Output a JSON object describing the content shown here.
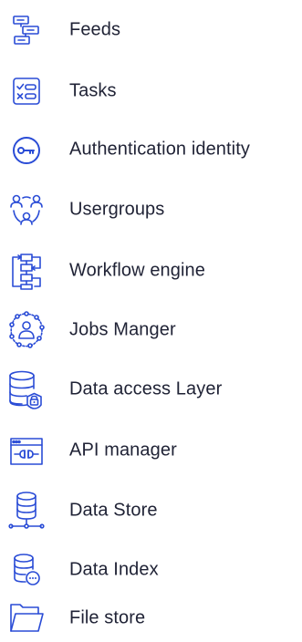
{
  "accent_color": "#2a4cd6",
  "text_color": "#1f2235",
  "menu": {
    "items": [
      {
        "label": "Feeds",
        "icon": "feeds-icon"
      },
      {
        "label": "Tasks",
        "icon": "tasks-icon"
      },
      {
        "label": "Authentication identity",
        "icon": "key-icon"
      },
      {
        "label": "Usergroups",
        "icon": "usergroups-icon"
      },
      {
        "label": "Workflow engine",
        "icon": "workflow-icon"
      },
      {
        "label": "Jobs Manger",
        "icon": "jobs-icon"
      },
      {
        "label": "Data access Layer",
        "icon": "database-lock-icon"
      },
      {
        "label": "API manager",
        "icon": "api-icon"
      },
      {
        "label": "Data Store",
        "icon": "database-network-icon"
      },
      {
        "label": "Data Index",
        "icon": "database-index-icon"
      },
      {
        "label": "File store",
        "icon": "folder-icon"
      }
    ]
  }
}
